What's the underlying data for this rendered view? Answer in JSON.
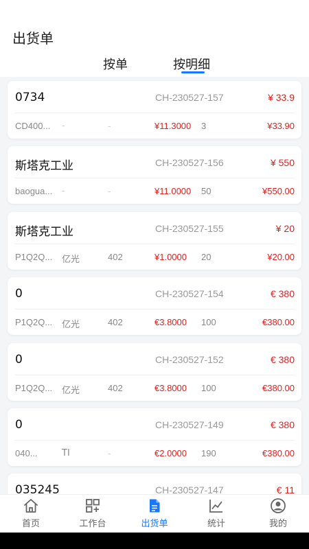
{
  "page": {
    "title": "出货单"
  },
  "tabs": [
    {
      "label": "按单"
    },
    {
      "label": "按明细"
    }
  ],
  "orders": [
    {
      "name": "0734",
      "code": "CH-230527-157",
      "total": "¥ 33.9",
      "sku": "CD400...",
      "brand": "-",
      "spec": "-",
      "unit_price": "¥11.3000",
      "qty": "3",
      "amount": "¥33.90"
    },
    {
      "name": "斯塔克工业",
      "code": "CH-230527-156",
      "total": "¥ 550",
      "sku": "baogua...",
      "brand": "-",
      "spec": "-",
      "unit_price": "¥11.0000",
      "qty": "50",
      "amount": "¥550.00"
    },
    {
      "name": "斯塔克工业",
      "code": "CH-230527-155",
      "total": "¥ 20",
      "sku": "P1Q2Q...",
      "brand": "亿光",
      "spec": "402",
      "unit_price": "¥1.0000",
      "qty": "20",
      "amount": "¥20.00"
    },
    {
      "name": "0",
      "code": "CH-230527-154",
      "total": "€ 380",
      "sku": "P1Q2Q...",
      "brand": "亿光",
      "spec": "402",
      "unit_price": "€3.8000",
      "qty": "100",
      "amount": "€380.00"
    },
    {
      "name": "0",
      "code": "CH-230527-152",
      "total": "€ 380",
      "sku": "P1Q2Q...",
      "brand": "亿光",
      "spec": "402",
      "unit_price": "€3.8000",
      "qty": "100",
      "amount": "€380.00"
    },
    {
      "name": "0",
      "code": "CH-230527-149",
      "total": "€ 380",
      "sku": "040...",
      "brand": "TI",
      "spec": "-",
      "unit_price": "€2.0000",
      "qty": "190",
      "amount": "€380.00"
    },
    {
      "name": "035245",
      "code": "CH-230527-147",
      "total": "€ 11",
      "sku": "",
      "brand": "",
      "spec": "",
      "unit_price": "",
      "qty": "",
      "amount": ""
    }
  ],
  "tabbar": [
    {
      "label": "首页",
      "icon": "home-icon"
    },
    {
      "label": "工作台",
      "icon": "grid-plus-icon"
    },
    {
      "label": "出货单",
      "icon": "document-icon"
    },
    {
      "label": "统计",
      "icon": "chart-icon"
    },
    {
      "label": "我的",
      "icon": "user-icon"
    }
  ],
  "colors": {
    "accent": "#1677ff",
    "price": "#e02020",
    "muted": "#999999"
  }
}
